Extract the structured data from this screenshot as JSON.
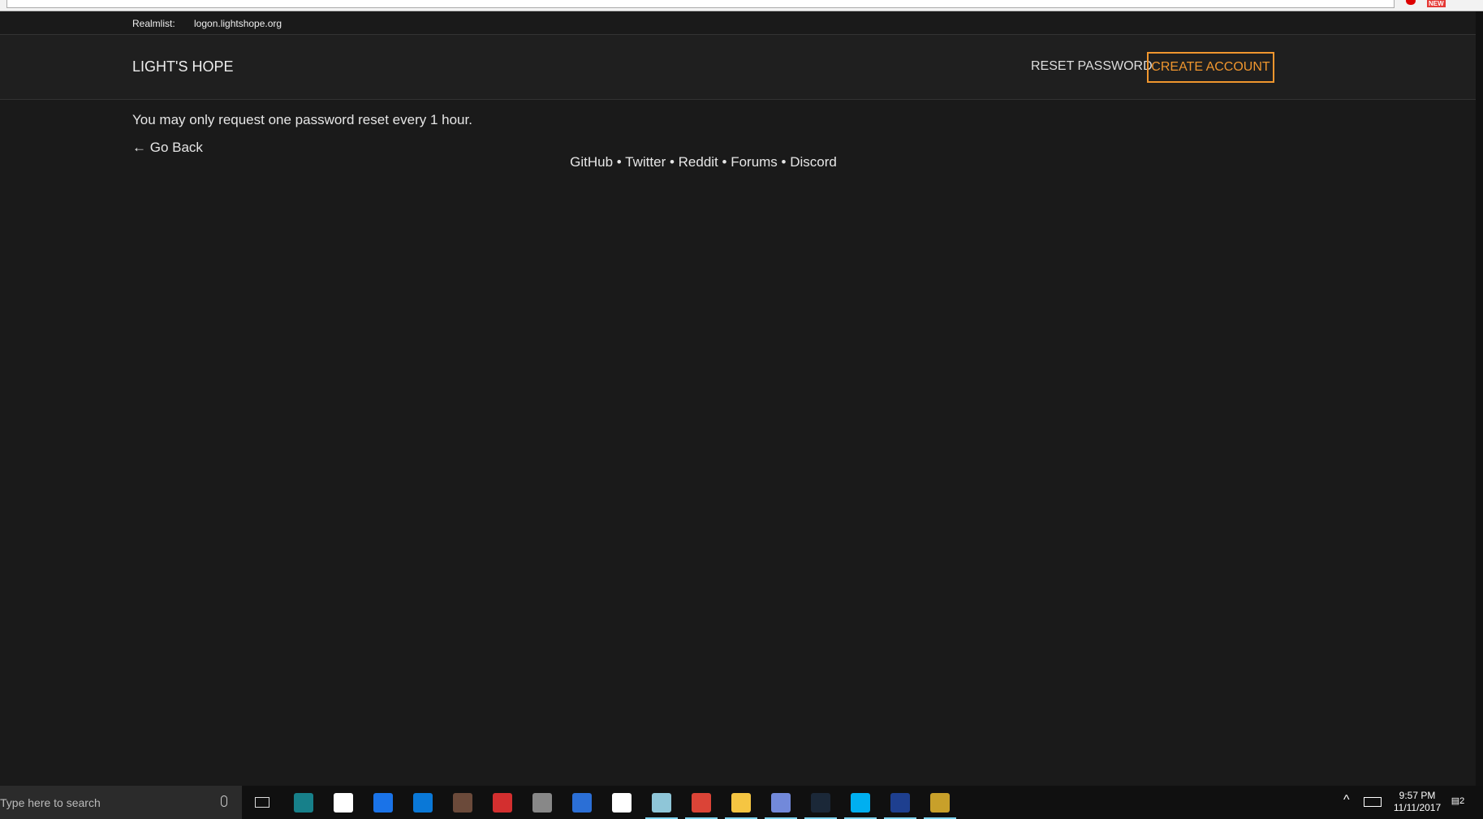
{
  "realmlist": {
    "label": "Realmlist:",
    "value": "logon.lightshope.org"
  },
  "header": {
    "logo": "LIGHT'S HOPE",
    "reset_password": "RESET PASSWORD",
    "create_account": "CREATE ACCOUNT"
  },
  "main": {
    "message": "You may only request one password reset every 1 hour.",
    "go_back": "← Go Back"
  },
  "footer": {
    "links": [
      "GitHub",
      "Twitter",
      "Reddit",
      "Forums",
      "Discord"
    ],
    "separator": " • "
  },
  "browser": {
    "badge": "NEW"
  },
  "taskbar": {
    "search_placeholder": "Type here to search",
    "time": "9:57 PM",
    "date": "11/11/2017",
    "notifications": "2",
    "apps": [
      {
        "name": "app-1",
        "color": "#17808a"
      },
      {
        "name": "store",
        "color": "#ffffff"
      },
      {
        "name": "app-g",
        "color": "#1a73e8"
      },
      {
        "name": "edge",
        "color": "#0a78d7"
      },
      {
        "name": "app-x",
        "color": "#6b4a3a"
      },
      {
        "name": "gift",
        "color": "#d32f2f"
      },
      {
        "name": "app-anime",
        "color": "#888888"
      },
      {
        "name": "app-circle",
        "color": "#2b6fd6"
      },
      {
        "name": "mail",
        "color": "#ffffff"
      },
      {
        "name": "app-notes",
        "color": "#8fc6d8"
      },
      {
        "name": "chrome",
        "color": "#db4437"
      },
      {
        "name": "file-explorer",
        "color": "#f5c542"
      },
      {
        "name": "discord",
        "color": "#7289da"
      },
      {
        "name": "steam",
        "color": "#1b2838"
      },
      {
        "name": "skype",
        "color": "#00aff0"
      },
      {
        "name": "app-blue",
        "color": "#1e3f8f"
      },
      {
        "name": "world-of-warcraft",
        "color": "#c8a02a"
      }
    ]
  },
  "colors": {
    "accent": "#f0962e",
    "background": "#1a1a1a",
    "header": "#1f1f1f"
  }
}
